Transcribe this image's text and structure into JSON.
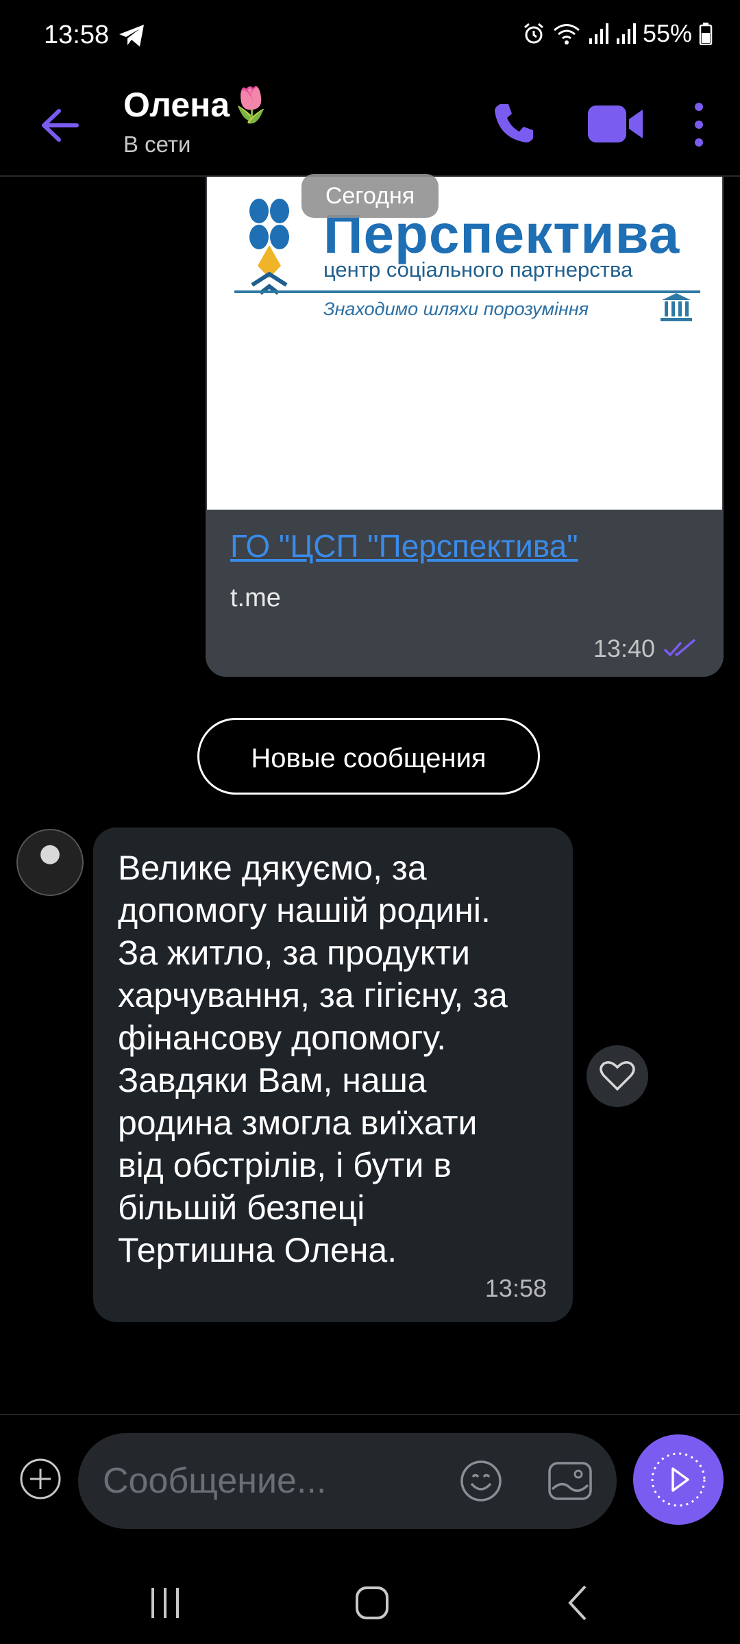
{
  "status_bar": {
    "time": "13:58",
    "battery": "55%",
    "icons": [
      "telegram-icon",
      "alarm-icon",
      "wifi-icon",
      "signal-icon",
      "signal-icon",
      "battery-icon"
    ]
  },
  "header": {
    "contact_name": "Олена🌷",
    "contact_status": "В сети",
    "icons": [
      "back-arrow-icon",
      "phone-icon",
      "video-camera-icon",
      "more-vert-icon"
    ]
  },
  "date_badge": "Сегодня",
  "link_card": {
    "preview": {
      "logo_title": "Перспектива",
      "logo_subtitle": "центр соціального партнерства",
      "logo_tagline": "Знаходимо шляхи порозуміння"
    },
    "title": "ГО \"ЦСП \"Перспектива\"",
    "domain": "t.me",
    "time": "13:40"
  },
  "new_messages_label": "Новые сообщения",
  "incoming_message": {
    "text": "Велике дякуємо, за\nдопомогу нашій родині.\nЗа житло, за продукти\nхарчування, за гігієну, за\nфінансову допомогу.\nЗавдяки Вам, наша\nродина змогла виїхати\nвід обстрілів, і бути в\nбільшій безпеці\nТертишна Олена.",
    "time": "13:58"
  },
  "composer": {
    "placeholder": "Сообщение..."
  },
  "colors": {
    "accent": "#7b5cf0",
    "link": "#3a8be9",
    "bubble_out": "#3d4148",
    "bubble_in": "#1f2429"
  }
}
